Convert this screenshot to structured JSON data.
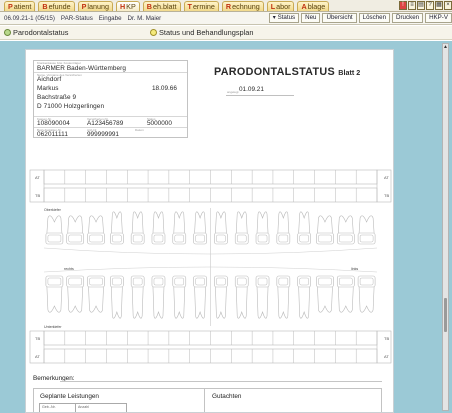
{
  "tabs": [
    {
      "mark": "P",
      "label": "atient"
    },
    {
      "mark": "B",
      "label": "efunde"
    },
    {
      "mark": "P",
      "label": "lanung"
    },
    {
      "mark": "H",
      "label": "KP"
    },
    {
      "mark": "B",
      "label": "eh.blatt"
    },
    {
      "mark": "T",
      "label": "ermine"
    },
    {
      "mark": "R",
      "label": "echnung"
    },
    {
      "mark": "L",
      "label": "abor"
    },
    {
      "mark": "A",
      "label": "blage"
    }
  ],
  "toolbar": {
    "left": [
      "06.09.21-1 (05/15)",
      "PAR-Status",
      "Eingabe",
      "Dr. M. Maier"
    ],
    "right": [
      "Status",
      "Neu",
      "Übersicht",
      "Löschen",
      "Drucken",
      "HKP-V"
    ]
  },
  "sections": {
    "a": "Parodontalstatus",
    "b": "Status und Behandlungsplan"
  },
  "patient": {
    "kasse_label": "Krankenkasse bzw. Kostenträger",
    "kasse": "BARMER Baden-Württemberg",
    "name_label": "Name, Vorname des Versicherten",
    "name1": "Aichdorf",
    "name2": "Markus",
    "geb": "18.09.66",
    "street": "Bachstraße 9",
    "city": "D 71000 Holzgerlingen",
    "kassennr_label": "Kassen-Nr.",
    "versnr_label": "Versicherten-Nr.",
    "status_label": "Status",
    "kassennr": "108090004",
    "versnr": "A123456789",
    "status": "5000000",
    "betrieb_label": "Betriebsstätten-Nr.",
    "arzt_label": "Arzt-Nr.",
    "datum_label": "Datum",
    "betrieb": "062011111",
    "arzt": "999999991"
  },
  "title": "PARODONTALSTATUS",
  "subtitle": "Blatt 2",
  "date_label": "angelegt",
  "date": "01.09.21",
  "chart": {
    "at": "AT",
    "tb": "TB",
    "oberkiefer": "Oberkiefer",
    "unterkiefer": "Unterkiefer",
    "rechts": "rechts",
    "links": "links"
  },
  "remarks": "Bemerkungen:",
  "bottom": {
    "left": "Geplante Leistungen",
    "right": "Gutachten",
    "col1": "Geb.-Nr.",
    "col2": "Anzahl"
  }
}
